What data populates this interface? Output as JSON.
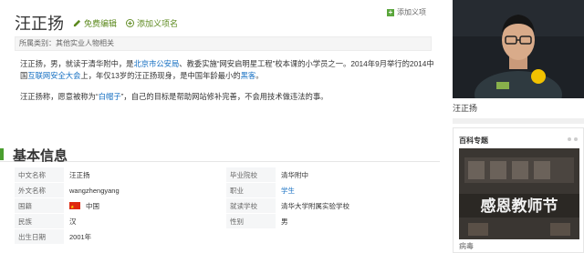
{
  "header": {
    "title": "汪正扬",
    "edit_label": "免费编辑",
    "add_synonym_label": "添加义项名",
    "add_tag_label": "添加义项"
  },
  "category": {
    "text": "所属类别：其他实业人物相关"
  },
  "intro": {
    "p1_part1": "汪正扬，男，就读于清华附中，是",
    "p1_link1": "北京市公安局",
    "p1_part2": "、教委实施“网安启明星工程”校本课的小学员之一。2014年9月举行的2014中国",
    "p1_link2": "互联网安全大会",
    "p1_part3": "上，年仅13岁的汪正扬现身，是中国年龄最小的",
    "p1_link3": "黑客",
    "p1_part4": "。",
    "p2_part1": "汪正扬称，愿意被称为“",
    "p2_link1": "白帽子",
    "p2_part2": "”，自己的目标是帮助网站修补完善，不会用技术做违法的事。"
  },
  "section": {
    "title": "基本信息"
  },
  "info_rows": [
    {
      "k1": "中文名称",
      "v1": "汪正扬",
      "k2": "毕业院校",
      "v2": "清华附中"
    },
    {
      "k1": "外文名称",
      "v1": "wangzhengyang",
      "k2": "职业",
      "v2": "学生"
    },
    {
      "k1": "国籍",
      "v1": "中国",
      "k2": "就读学校",
      "v2": "清华大学附属实验学校"
    },
    {
      "k1": "民族",
      "v1": "汉",
      "k2": "性别",
      "v2": "男"
    },
    {
      "k1": "出生日期",
      "v1": "2001年",
      "k2": "",
      "v2": ""
    }
  ],
  "sidebar": {
    "photo_caption": "汪正扬",
    "card_title": "百科专题",
    "card_image_text": "感恩教师节",
    "card_footer": "病毒"
  },
  "colors": {
    "link": "#136ec2",
    "accent_green": "#4a9e2f",
    "table_key_bg": "#f5f6f7"
  }
}
